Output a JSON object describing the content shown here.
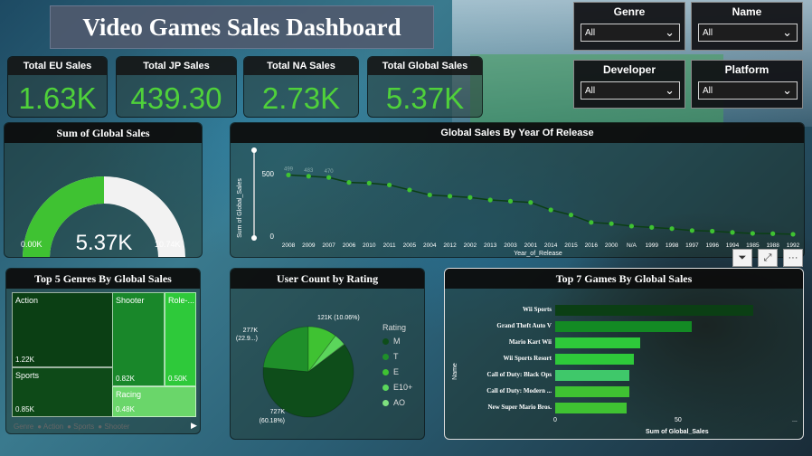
{
  "title": "Video Games Sales Dashboard",
  "slicers": [
    {
      "label": "Genre",
      "value": "All"
    },
    {
      "label": "Name",
      "value": "All"
    },
    {
      "label": "Developer",
      "value": "All"
    },
    {
      "label": "Platform",
      "value": "All"
    }
  ],
  "kpis": [
    {
      "label": "Total EU Sales",
      "value": "1.63K"
    },
    {
      "label": "Total JP Sales",
      "value": "439.30"
    },
    {
      "label": "Total NA Sales",
      "value": "2.73K"
    },
    {
      "label": "Total Global Sales",
      "value": "5.37K"
    }
  ],
  "colors": {
    "accent": "#4fd13a",
    "dark_green": "#0e4d1a",
    "mid_green": "#1f8f2a",
    "light_green": "#5bd65b"
  },
  "gauge": {
    "title": "Sum of Global Sales",
    "value": "5.37K",
    "min": "0.00K",
    "max": "10.74K",
    "fraction": 0.5
  },
  "line_chart": {
    "title": "Global Sales By Year Of Release",
    "ylabel": "Sum of Global_Sales",
    "xlabel": "Year_of_Release",
    "ytick_top": "500",
    "ytick_bottom": "0"
  },
  "treemap": {
    "title": "Top 5 Genres By Global Sales",
    "cells": [
      {
        "name": "Action",
        "value": "1.22K"
      },
      {
        "name": "Shooter",
        "value": "0.82K"
      },
      {
        "name": "Role-...",
        "value": "0.50K"
      },
      {
        "name": "Sports",
        "value": "0.85K"
      },
      {
        "name": "Racing",
        "value": "0.48K"
      }
    ],
    "legend_title": "Genre",
    "legend_items": [
      "Action",
      "Sports",
      "Shooter"
    ]
  },
  "pie": {
    "title": "User Count by Rating",
    "label_top": "121K (10.06%)",
    "label_left_1": "277K",
    "label_left_2": "(22.9...)",
    "label_bottom_1": "727K",
    "label_bottom_2": "(60.18%)",
    "legend_title": "Rating",
    "legend_items": [
      "M",
      "T",
      "E",
      "E10+",
      "AO"
    ]
  },
  "bar_chart": {
    "title": "Top 7 Games By Global Sales",
    "ylabel": "Name",
    "xlabel": "Sum of Global_Sales",
    "xtick_0": "0",
    "xtick_50": "50",
    "more": "..."
  },
  "visual_icons": {
    "filter": "filter-icon",
    "focus": "focus-mode-icon",
    "more": "···"
  },
  "chart_data": [
    {
      "type": "line",
      "title": "Global Sales By Year Of Release",
      "xlabel": "Year_of_Release",
      "ylabel": "Sum of Global_Sales",
      "x": [
        "2008",
        "2009",
        "2007",
        "2006",
        "2010",
        "2011",
        "2005",
        "2004",
        "2012",
        "2002",
        "2013",
        "2003",
        "2001",
        "2014",
        "2015",
        "2016",
        "2000",
        "N/A",
        "1999",
        "1998",
        "1997",
        "1996",
        "1994",
        "1985",
        "1988",
        "1992"
      ],
      "values": [
        490,
        480,
        470,
        430,
        425,
        410,
        370,
        330,
        320,
        310,
        290,
        280,
        270,
        210,
        170,
        110,
        100,
        80,
        70,
        60,
        45,
        40,
        30,
        22,
        20,
        15
      ],
      "ylim": [
        0,
        550
      ],
      "data_labels_top": [
        "499",
        "483",
        "470"
      ]
    },
    {
      "type": "pie",
      "title": "User Count by Rating",
      "labels": [
        "M",
        "T",
        "E",
        "E10+",
        "AO"
      ],
      "values": [
        727,
        277,
        121,
        50,
        2
      ],
      "value_labels": [
        "727K (60.18%)",
        "277K (22.9...)",
        "121K (10.06%)"
      ]
    },
    {
      "type": "bar",
      "title": "Top 7 Games By Global Sales",
      "categories": [
        "Wii Sports",
        "Grand Theft Auto V",
        "Mario Kart Wii",
        "Wii Sports Resort",
        "Call of Duty: Black Ops",
        "Call of Duty: Modern ...",
        "New Super Mario Bros."
      ],
      "values": [
        82.5,
        56.6,
        35.5,
        32.8,
        31.0,
        30.8,
        29.6
      ],
      "xlabel": "Sum of Global_Sales",
      "ylabel": "Name",
      "xlim": [
        0,
        85
      ]
    }
  ]
}
